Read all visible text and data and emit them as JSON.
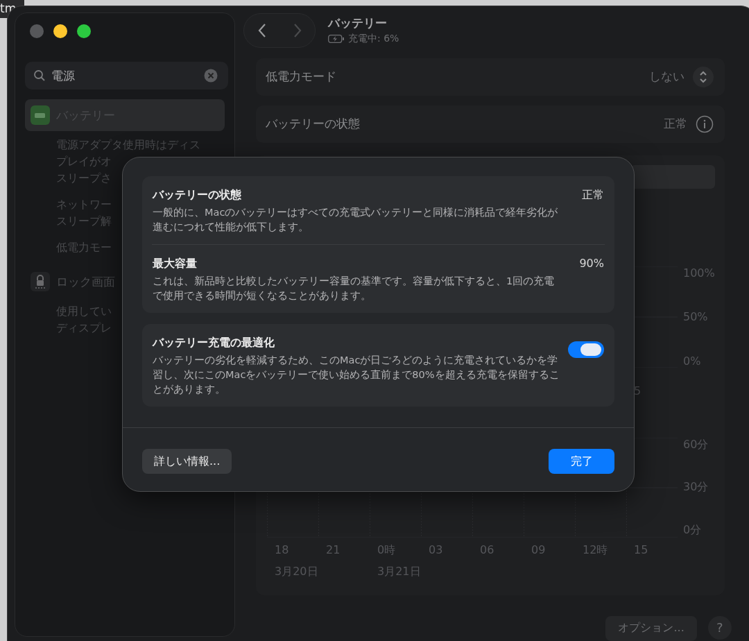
{
  "background_window": {
    "text": "tm"
  },
  "window": {
    "controls": [
      {
        "color": "#56575a"
      },
      {
        "color": "#fec62e"
      },
      {
        "color": "#2bc840"
      }
    ]
  },
  "search": {
    "value": "電源"
  },
  "sidebar": {
    "items": [
      {
        "label": "バッテリー",
        "kind": "battery",
        "selected": true,
        "results": [
          [
            "電源アダプタ使用時はディス",
            "プレイがオ",
            "スリープさ"
          ],
          [
            "ネットワー",
            "スリープ解"
          ],
          [
            "低電力モー"
          ]
        ]
      },
      {
        "label": "ロック画面",
        "kind": "lock",
        "selected": false,
        "results": [
          [
            "使用してい",
            "ディスプレ"
          ]
        ]
      }
    ]
  },
  "header": {
    "title": "バッテリー",
    "status": "充電中: 6%",
    "back_enabled": true,
    "forward_enabled": false
  },
  "settings": [
    {
      "kind": "popup",
      "label": "低電力モード",
      "value": "しない"
    },
    {
      "kind": "info",
      "label": "バッテリーの状態",
      "value": "正常"
    }
  ],
  "charts": {
    "level_labels": [
      "100%",
      "50%",
      "0%"
    ],
    "level_x_labels": [
      "5"
    ],
    "usage_labels": [
      "60分",
      "30分",
      "0分"
    ],
    "x_labels": [
      "18",
      "21",
      "0時",
      "03",
      "06",
      "09",
      "12時",
      "15"
    ],
    "dates": [
      "3月20日",
      "3月21日"
    ]
  },
  "footer": {
    "options": "オプション...",
    "help": "?"
  },
  "sheet": {
    "groups": [
      [
        {
          "title": "バッテリーの状態",
          "value": "正常",
          "description": "一般的に、Macのバッテリーはすべての充電式バッテリーと同様に消耗品で経年劣化が進むにつれて性能が低下します。"
        },
        {
          "title": "最大容量",
          "value": "90%",
          "description": "これは、新品時と比較したバッテリー容量の基準です。容量が低下すると、1回の充電で使用できる時間が短くなることがあります。"
        }
      ],
      [
        {
          "title": "バッテリー充電の最適化",
          "toggle": true,
          "description": "バッテリーの劣化を軽減するため、このMacが日ごろどのように充電されているかを学習し、次にこのMacをバッテリーで使い始める直前まで80%を超える充電を保留することがあります。"
        }
      ]
    ],
    "buttons": [
      {
        "label": "詳しい情報...",
        "kind": "secondary"
      },
      {
        "label": "完了",
        "kind": "primary"
      }
    ]
  }
}
